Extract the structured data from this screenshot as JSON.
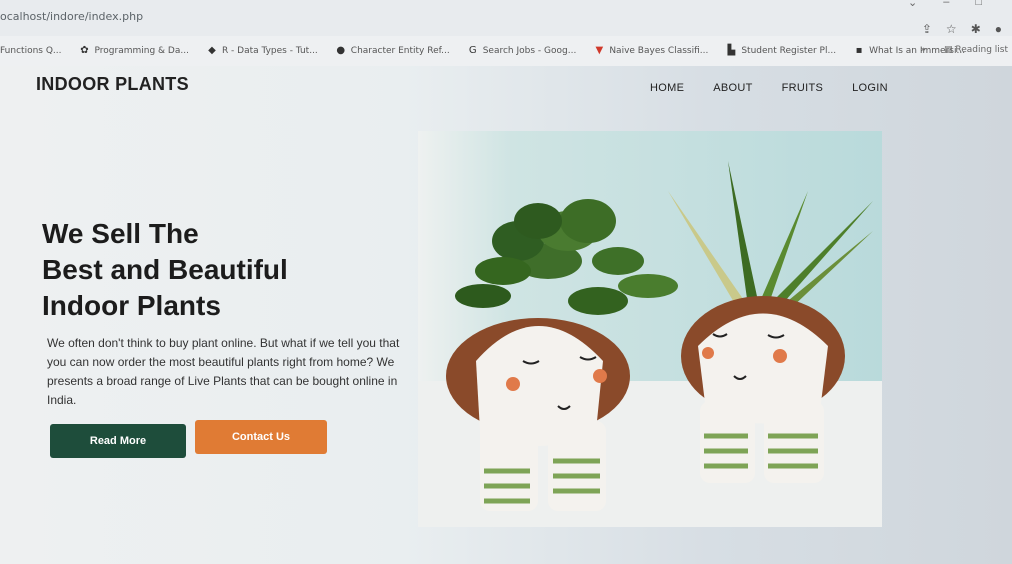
{
  "browser": {
    "url": "ocalhost/indore/index.php",
    "bookmarks": [
      {
        "icon": "document-icon",
        "label": "Functions Q..."
      },
      {
        "icon": "plant-icon",
        "label": "Programming & Da..."
      },
      {
        "icon": "tag-icon",
        "label": "R - Data Types - Tut..."
      },
      {
        "icon": "globe-icon",
        "label": "Character Entity Ref..."
      },
      {
        "icon": "google-icon",
        "label": "Search Jobs - Goog..."
      },
      {
        "icon": "triangle-icon",
        "label": "Naive Bayes Classifi..."
      },
      {
        "icon": "person-icon",
        "label": "Student Register Pl..."
      },
      {
        "icon": "document-icon",
        "label": "What Is an Immersi..."
      }
    ],
    "reading_list": "Reading list"
  },
  "site": {
    "brand": "INDOOR PLANTS",
    "nav": [
      "HOME",
      "ABOUT",
      "FRUITS",
      "LOGIN"
    ]
  },
  "hero": {
    "title_lines": [
      "We Sell The",
      "Best and Beautiful",
      "Indoor Plants"
    ],
    "text": "We often don't think to buy plant online. But what if we tell you that you can now order the most beautiful plants right from home? We presents a broad range of Live Plants that can be bought online in India.",
    "read_more": "Read More",
    "contact_us": "Contact Us"
  },
  "colors": {
    "read_more_bg": "#1e4d3b",
    "contact_bg": "#e07b34"
  }
}
